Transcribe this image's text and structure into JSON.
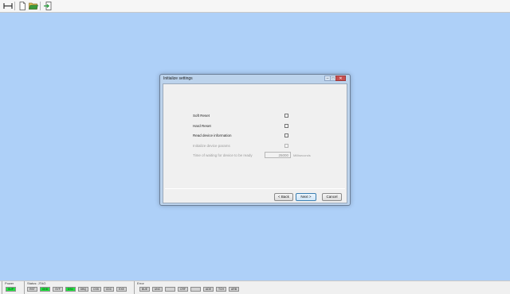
{
  "toolbar": {
    "icons": [
      "connect-icon",
      "new-file-icon",
      "open-folder-icon",
      "exit-icon"
    ]
  },
  "dialog": {
    "title": "Initialize settings",
    "window_controls": [
      "–",
      "□",
      "✕"
    ],
    "rows": [
      {
        "label": "Soft Reset",
        "enabled": true,
        "checked": false
      },
      {
        "label": "Hard Reset",
        "enabled": true,
        "checked": false
      },
      {
        "label": "Read device information",
        "enabled": true,
        "checked": false
      },
      {
        "label": "Initialize device params",
        "enabled": false,
        "checked": false
      }
    ],
    "wait_label": "Time of waiting for device to be ready",
    "wait_value": "25000",
    "wait_unit": "Milliseconds",
    "buttons": {
      "back": "< Back",
      "next": "Next >",
      "cancel": "Cancel"
    }
  },
  "statusbar": {
    "power": {
      "label": "Power",
      "items": [
        {
          "text": "SUP",
          "on": true
        }
      ]
    },
    "status": {
      "label": "Status: JTAG",
      "items": [
        {
          "text": "RST",
          "on": false
        },
        {
          "text": "ODD",
          "on": true
        },
        {
          "text": "SYF",
          "on": false
        },
        {
          "text": "DSC",
          "on": true
        },
        {
          "text": "DBQ",
          "on": false
        },
        {
          "text": "CSS",
          "on": false
        },
        {
          "text": "CDC",
          "on": false
        },
        {
          "text": "EXE",
          "on": false
        }
      ]
    },
    "error": {
      "label": "Error",
      "items": [
        {
          "text": "BUE",
          "on": false
        },
        {
          "text": "UNC",
          "on": false
        },
        {
          "text": "",
          "on": false
        },
        {
          "text": "CRF",
          "on": false
        },
        {
          "text": "",
          "on": false
        },
        {
          "text": "ADE",
          "on": false
        },
        {
          "text": "TCH",
          "on": false
        },
        {
          "text": "ARB",
          "on": false
        }
      ]
    }
  }
}
